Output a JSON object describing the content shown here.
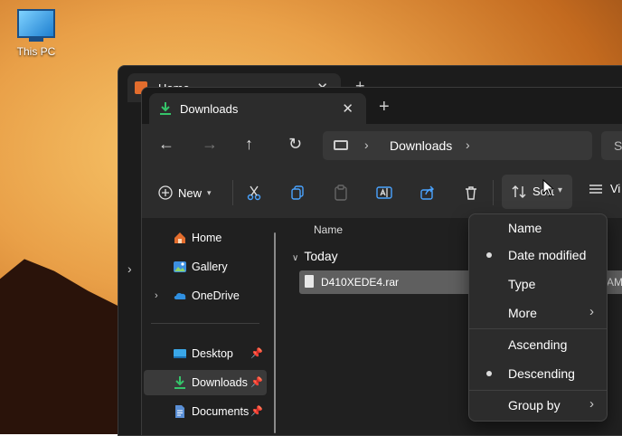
{
  "desktop": {
    "icon_label": "This PC"
  },
  "back_window": {
    "tab_title": "Home",
    "close": "✕",
    "new_tab": "+"
  },
  "front_window": {
    "tab_title": "Downloads",
    "close": "✕",
    "new_tab": "+",
    "nav": {
      "back": "←",
      "forward": "→",
      "up": "↑",
      "refresh": "↻"
    },
    "address": {
      "separator": "›",
      "crumb": "Downloads"
    },
    "search_placeholder": "S",
    "toolbar": {
      "new_label": "New",
      "sort_label": "Sort",
      "view_label": "Vi"
    },
    "sidebar": {
      "items": [
        {
          "label": "Home"
        },
        {
          "label": "Gallery"
        },
        {
          "label": "OneDrive"
        },
        {
          "label": "Desktop"
        },
        {
          "label": "Downloads"
        },
        {
          "label": "Documents"
        }
      ]
    },
    "files": {
      "column_name": "Name",
      "group": "Today",
      "rows": [
        {
          "name": "D410XEDE4.rar",
          "time_suffix": "AM"
        }
      ]
    }
  },
  "sort_menu": {
    "items": [
      {
        "label": "Name",
        "selected": false
      },
      {
        "label": "Date modified",
        "selected": true
      },
      {
        "label": "Type",
        "selected": false
      },
      {
        "label": "More",
        "submenu": true
      },
      {
        "label": "Ascending",
        "selected": false
      },
      {
        "label": "Descending",
        "selected": true
      },
      {
        "label": "Group by",
        "submenu": true
      }
    ],
    "submenu_arrow": "›"
  },
  "colors": {
    "accent_green": "#35c46a",
    "folder_blue": "#2f8fe0",
    "window_bg": "#202020"
  }
}
